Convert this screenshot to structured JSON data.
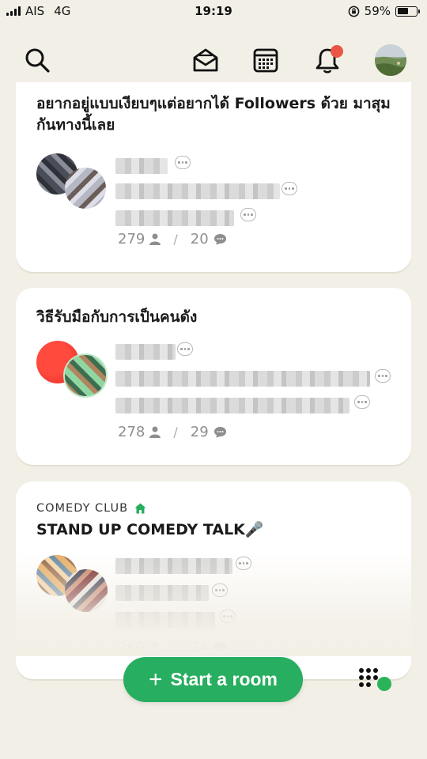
{
  "status_bar": {
    "carrier": "AIS",
    "network": "4G",
    "time": "19:19",
    "battery": "59%",
    "battery_level": 0.59
  },
  "nav": {
    "icons": [
      "search-icon",
      "envelope-icon",
      "calendar-icon",
      "bell-icon",
      "profile-avatar"
    ],
    "has_notification": true
  },
  "rooms": [
    {
      "title": "อยากอยู่แบบเงียบๆแต่อยากได้ Followers ด้วย มาสุมกันทางนี้เลย",
      "club": "",
      "listeners": "279",
      "speaking": "20"
    },
    {
      "title": "วิธีรับมือกับการเป็นคนดัง",
      "club": "",
      "listeners": "278",
      "speaking": "29"
    },
    {
      "title": "STAND UP COMEDY TALK🎤",
      "club": "COMEDY CLUB",
      "listeners": "269",
      "speaking": "24"
    }
  ],
  "actions": {
    "start_room": "Start a room",
    "start_room_icon": "+"
  },
  "colors": {
    "background": "#f2efe6",
    "accent_green": "#27ae60",
    "notification_red": "#eb5545",
    "muted_text": "#8e8e8e"
  }
}
